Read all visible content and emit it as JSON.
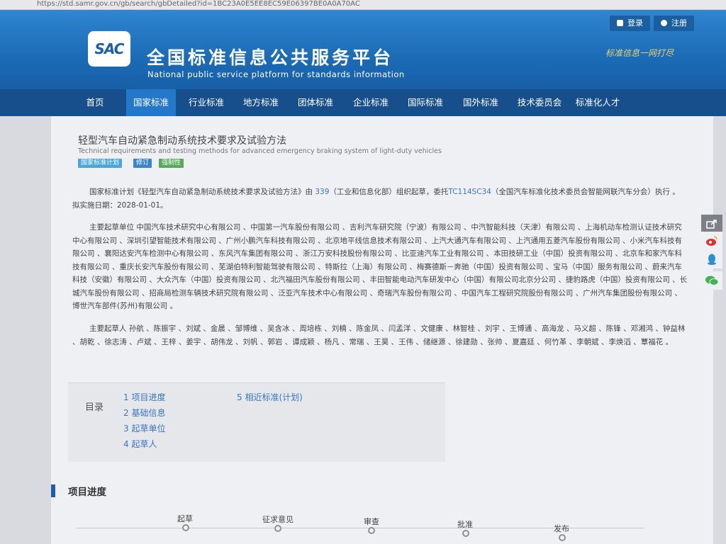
{
  "browser": {
    "url": "https://std.samr.gov.cn/gb/search/gbDetailed?id=1BC23A0E5EE8EC59E06397BE0A0A70AC"
  },
  "header": {
    "login_label": "登录",
    "register_label": "注册",
    "logo_text": "SAC",
    "site_title": "全国标准信息公共服务平台",
    "site_subtitle": "National public service platform  for standards information",
    "slogan": "标准信息一网打尽"
  },
  "nav": {
    "items": [
      "首页",
      "国家标准",
      "行业标准",
      "地方标准",
      "团体标准",
      "企业标准",
      "国际标准",
      "国外标准",
      "技术委员会",
      "标准化人才"
    ],
    "active": "国家标准"
  },
  "doc": {
    "title": "轻型汽车自动紧急制动系统技术要求及试验方法",
    "title_en": "Technical requirements and testing methods for advanced emergency braking system of light-duty vehicles",
    "tags": [
      "国家标准计划",
      "修订",
      "强制性"
    ],
    "intro_a": "国家标准计划《轻型汽车自动紧急制动系统技术要求及试验方法》由 ",
    "intro_num": "339",
    "intro_b": "（工业和信息化部）组织起草，委托",
    "intro_tc": "TC114SC34",
    "intro_c": "（全国汽车标准化技术委员会智能网联汽车分会）执行 。 拟实施日期：2028-01-01。",
    "drafting_units": "主要起草单位 中国汽车技术研究中心有限公司 、中国第一汽车股份有限公司 、吉利汽车研究院（宁波）有限公司 、中汽智能科技（天津）有限公司 、上海机动车检测认证技术研究中心有限公司 、深圳引望智能技术有限公司 、广州小鹏汽车科技有限公司 、北京地平线信息技术有限公司 、上汽大通汽车有限公司 、上汽通用五菱汽车股份有限公司 、小米汽车科技有限公司 、襄阳达安汽车检测中心有限公司 、东风汽车集团有限公司 、浙江万安科技股份有限公司 、比亚迪汽车工业有限公司 、本田技研工业（中国）投资有限公司 、北京车和家汽车科技有限公司 、重庆长安汽车股份有限公司 、芜湖伯特利智能驾驶有限公司 、特斯拉（上海）有限公司 、梅赛德斯－奔驰（中国）投资有限公司 、宝马（中国）服务有限公司 、蔚来汽车科技（安徽）有限公司 、大众汽车（中国）投资有限公司 、北汽福田汽车股份有限公司 、丰田智能电动汽车研发中心（中国）有限公司北京分公司 、捷豹路虎（中国）投资有限公司 、长城汽车股份有限公司 、招商局检测车辆技术研究院有限公司 、泛亚汽车技术中心有限公司 、奇瑞汽车股份有限公司 、中国汽车工程研究院股份有限公司 、广州汽车集团股份有限公司 、博世汽车部件(苏州)有限公司 。",
    "drafters": "主要起草人 孙航 、陈振宇 、刘斌 、金晨 、邹博维 、吴含冰 、周培栋 、刘楠 、陈金凤 、闫孟洋 、文健康 、林智桂 、刘宇 、王博通 、高海龙 、马义超 、陈锋 、邓湘鸿 、钟益林 、胡乾 、徐志涛 、卢斌 、王梓 、姜宇 、胡伟龙 、刘帆 、郭岩 、谭成颖 、杨凡 、常瑞 、王昊 、王伟 、储继源 、徐建勋 、张帅 、夏嘉廷 、何竹革 、李朝斌 、李焕滔 、覃福花 。"
  },
  "toc": {
    "label": "目录",
    "items": [
      "1 项目进度",
      "2 基础信息",
      "3 起草单位",
      "4 起草人",
      "5 相近标准(计划)"
    ]
  },
  "progress": {
    "section_title": "项目进度",
    "stages": [
      "起草",
      "征求意见",
      "审查",
      "批准",
      "发布"
    ]
  }
}
